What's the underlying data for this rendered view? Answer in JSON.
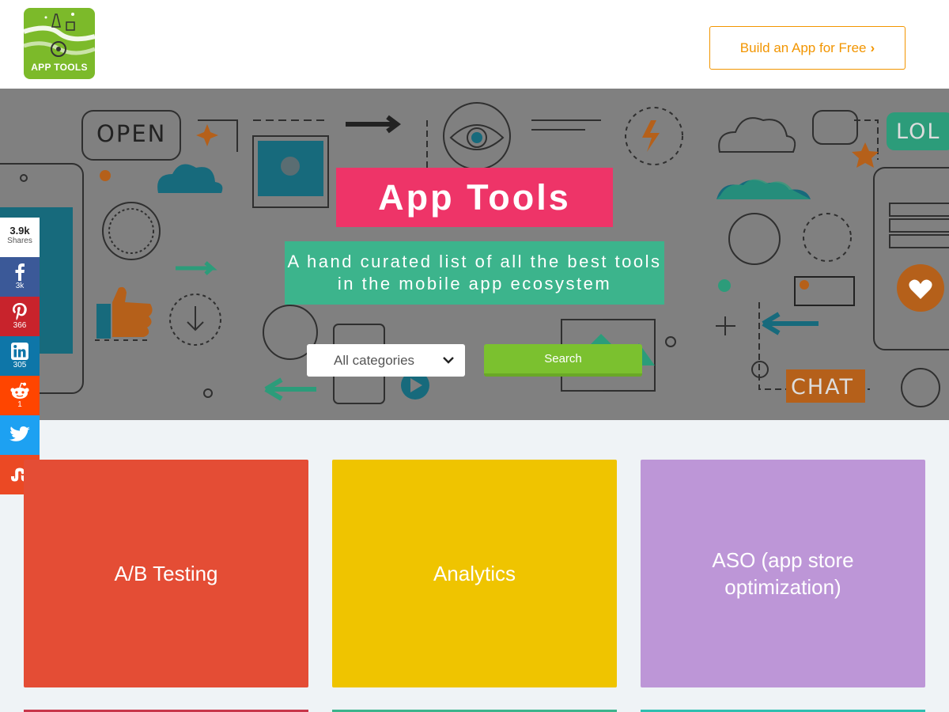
{
  "header": {
    "logo_text": "APP TOOLS",
    "build_button_label": "Build an App for Free",
    "build_button_chevron": "›"
  },
  "hero": {
    "title": "App Tools",
    "subtitle": "A hand curated list of all the best tools in the mobile app ecosystem",
    "doodle_labels": {
      "open": "OPEN",
      "lol": "LOL",
      "chat": "CHAT"
    },
    "category_select": {
      "selected": "All categories"
    },
    "search_button_label": "Search"
  },
  "share": {
    "total": "3.9k",
    "total_label": "Shares",
    "buttons": [
      {
        "network": "facebook",
        "icon": "facebook-icon",
        "count": "3k",
        "color": "#3b5998"
      },
      {
        "network": "pinterest",
        "icon": "pinterest-icon",
        "count": "366",
        "color": "#c8232c"
      },
      {
        "network": "linkedin",
        "icon": "linkedin-icon",
        "count": "305",
        "color": "#0e76a8"
      },
      {
        "network": "reddit",
        "icon": "reddit-icon",
        "count": "1",
        "color": "#ff4500"
      },
      {
        "network": "twitter",
        "icon": "twitter-icon",
        "count": "",
        "color": "#1da1f2"
      },
      {
        "network": "stumbleupon",
        "icon": "stumbleupon-icon",
        "count": "",
        "color": "#eb4924"
      }
    ]
  },
  "categories": [
    {
      "label": "A/B Testing",
      "color": "#e44d35"
    },
    {
      "label": "Analytics",
      "color": "#efc400"
    },
    {
      "label": "ASO (app store optimization)",
      "color": "#bd96d7"
    }
  ],
  "colors": {
    "accent_orange": "#f29500",
    "hero_title_bg": "#ee3468",
    "hero_subtitle_bg": "#3cb48c",
    "search_green": "#7bc12f",
    "page_bg": "#eff3f6"
  }
}
